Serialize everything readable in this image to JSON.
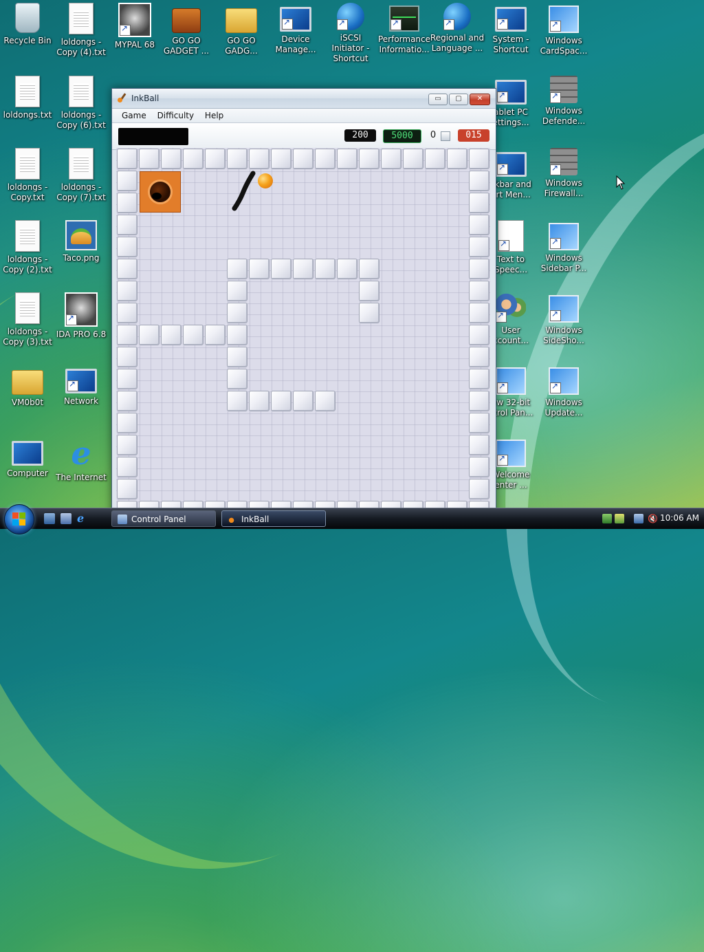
{
  "desktop": {
    "icons": [
      {
        "label": "Recycle Bin",
        "icon": "recycle-bin-icon"
      },
      {
        "label": "loldongs - Copy (4).txt",
        "icon": "text-file-icon"
      },
      {
        "label": "MYPAL 68",
        "icon": "raccoon-browser-icon"
      },
      {
        "label": "GO GO GADGET ...",
        "icon": "briefcase-icon"
      },
      {
        "label": "GO GO GADG...",
        "icon": "folder-7-icon"
      },
      {
        "label": "Device Manage...",
        "icon": "device-manager-icon"
      },
      {
        "label": "iSCSI Initiator - Shortcut",
        "icon": "globe-shield-icon"
      },
      {
        "label": "Performance Informatio...",
        "icon": "performance-monitor-icon"
      },
      {
        "label": "Regional and Language ...",
        "icon": "globe-clock-icon"
      },
      {
        "label": "System - Shortcut",
        "icon": "system-icon"
      },
      {
        "label": "Windows CardSpac...",
        "icon": "cardspace-icon"
      },
      {
        "label": "loldongs.txt",
        "icon": "text-file-icon"
      },
      {
        "label": "loldongs - Copy (6).txt",
        "icon": "text-file-icon"
      },
      {
        "label": "loldongs - Copy.txt",
        "icon": "text-file-icon"
      },
      {
        "label": "loldongs - Copy (7).txt",
        "icon": "text-file-icon"
      },
      {
        "label": "loldongs - Copy (2).txt",
        "icon": "text-file-icon"
      },
      {
        "label": "Taco.png",
        "icon": "image-file-icon"
      },
      {
        "label": "loldongs - Copy (3).txt",
        "icon": "text-file-icon"
      },
      {
        "label": "IDA PRO 6.8",
        "icon": "ida-pro-icon"
      },
      {
        "label": "VM0b0t",
        "icon": "folder-icon"
      },
      {
        "label": "Network",
        "icon": "network-icon"
      },
      {
        "label": "Computer",
        "icon": "computer-icon"
      },
      {
        "label": "The Internet",
        "icon": "internet-explorer-icon"
      },
      {
        "label": "ablet PC ettings...",
        "icon": "tablet-pc-icon"
      },
      {
        "label": "Windows Defende...",
        "icon": "defender-icon"
      },
      {
        "label": "skbar and art Men...",
        "icon": "taskbar-icon"
      },
      {
        "label": "Windows Firewall...",
        "icon": "firewall-icon"
      },
      {
        "label": "Text to Speec...",
        "icon": "speech-icon"
      },
      {
        "label": "Windows Sidebar P...",
        "icon": "sidebar-icon"
      },
      {
        "label": "User ccount...",
        "icon": "user-accounts-icon"
      },
      {
        "label": "Windows SideSho...",
        "icon": "sideshow-icon"
      },
      {
        "label": "ew 32-bit ntrol Pan...",
        "icon": "control-panel-icon"
      },
      {
        "label": "Windows Update...",
        "icon": "windows-update-icon"
      },
      {
        "label": "Welcome enter ...",
        "icon": "welcome-center-icon"
      }
    ]
  },
  "window": {
    "title": "InkBall",
    "menu": [
      "Game",
      "Difficulty",
      "Help"
    ],
    "scores": {
      "left": "200",
      "middle": "5000",
      "balls": "0",
      "timer": "015"
    },
    "buttons": {
      "minimize": "▭",
      "maximize": "▢",
      "close": "✕"
    }
  },
  "taskbar": {
    "tasks": [
      "Control Panel",
      "InkBall"
    ],
    "clock": "10:06 AM"
  },
  "colors": {
    "accent_orange": "#e27d2a",
    "timer_red": "#c8412b",
    "score_green": "#4fe07a"
  }
}
